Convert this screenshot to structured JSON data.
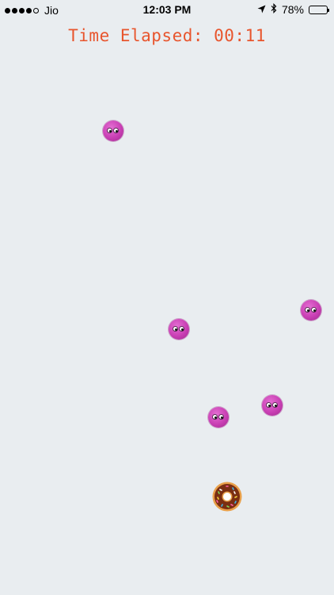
{
  "status_bar": {
    "carrier": "Jio",
    "time": "12:03 PM",
    "battery_percent": "78%",
    "battery_level": 0.78,
    "signal_bars_filled": 4,
    "signal_bars_total": 5
  },
  "game": {
    "timer_text": "Time Elapsed: 00:11",
    "enemy_count": 5,
    "player_icon": "donut-icon",
    "enemy_icon": "pink-blob-icon"
  },
  "colors": {
    "background": "#e9edf0",
    "timer": "#e8552d",
    "enemy": "#c93fb4",
    "battery_fill": "#f2c200"
  }
}
